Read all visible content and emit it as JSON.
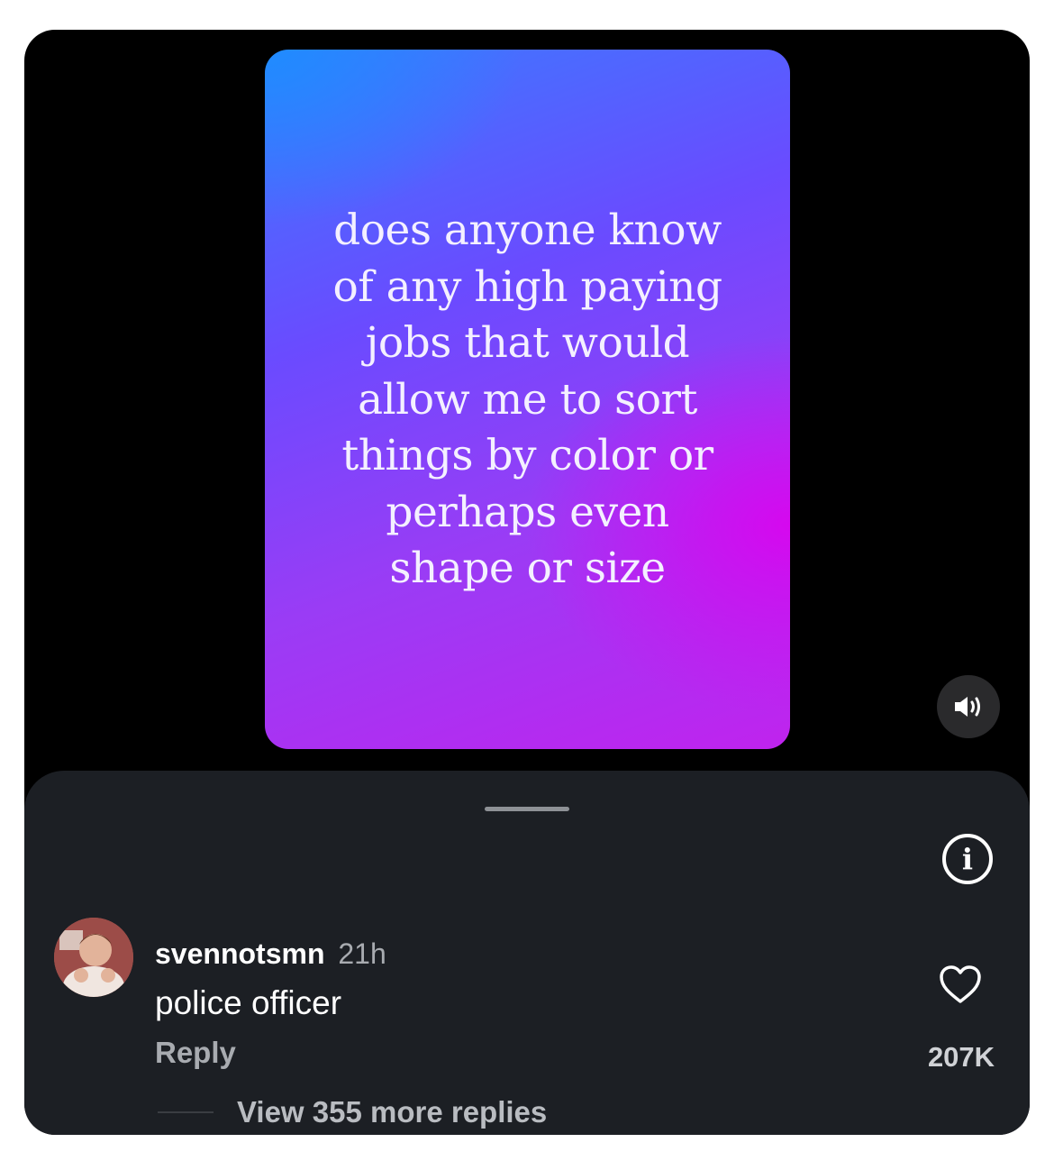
{
  "post": {
    "text": "does anyone know\nof any high paying\njobs that would\nallow me to sort\nthings by color or\nperhaps even\nshape or size"
  },
  "controls": {
    "sound_icon": "speaker-icon",
    "info_icon": "info-icon",
    "info_glyph": "i"
  },
  "comment": {
    "username": "svennotsmn",
    "time": "21h",
    "text": "police officer",
    "reply_label": "Reply",
    "like_icon": "heart-icon",
    "like_count": "207K",
    "view_replies_label": "View 355 more replies"
  },
  "colors": {
    "page_bg": "#ffffff",
    "frame_bg": "#000000",
    "sheet_bg": "#1c1f24",
    "gradient_blue": "#3a7cff",
    "gradient_magenta": "#de00ee",
    "muted_text": "#a8abb0"
  }
}
